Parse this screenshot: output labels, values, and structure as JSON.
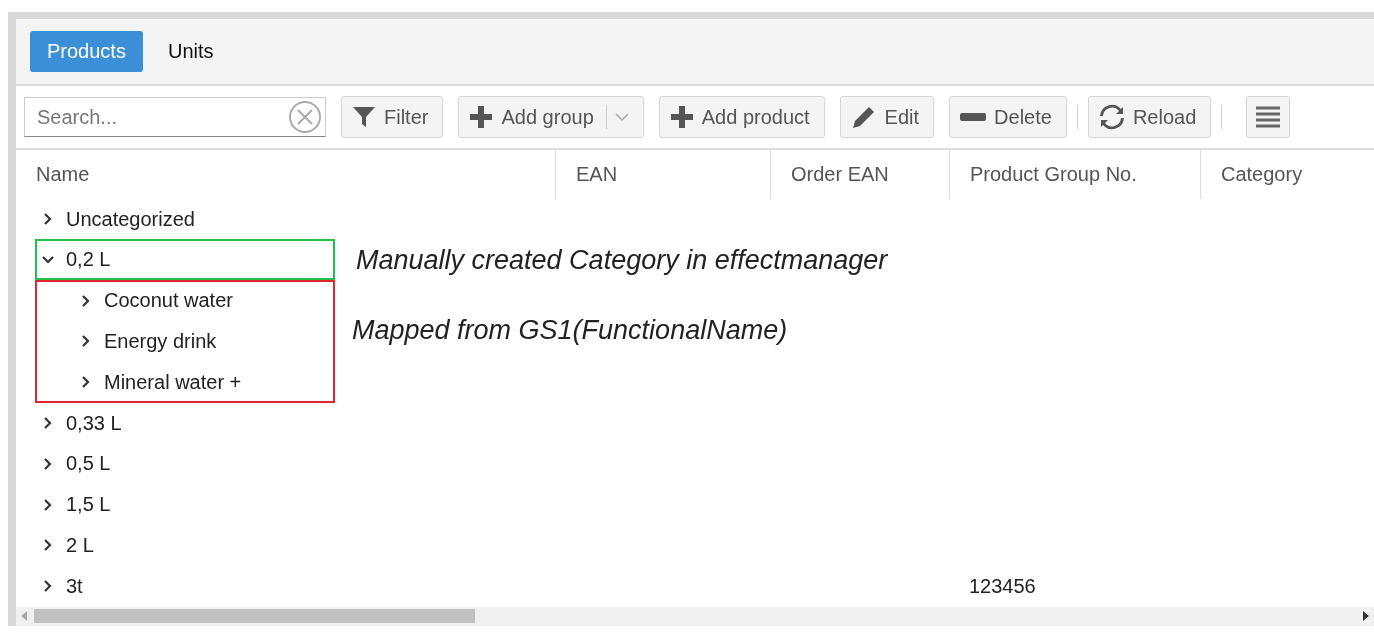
{
  "tabs": [
    {
      "label": "Products",
      "selected": true
    },
    {
      "label": "Units",
      "selected": false
    }
  ],
  "toolbar": {
    "search": {
      "placeholder": "Search..."
    },
    "items": [
      {
        "kind": "button",
        "label": "Filter"
      },
      {
        "kind": "split",
        "label": "Add group"
      },
      {
        "kind": "button",
        "label": "Add product"
      },
      {
        "kind": "button",
        "label": "Edit"
      },
      {
        "kind": "button",
        "label": "Delete"
      },
      {
        "kind": "separator"
      },
      {
        "kind": "button",
        "label": "Reload"
      },
      {
        "kind": "separator"
      },
      {
        "kind": "icon"
      }
    ]
  },
  "table": {
    "columns": [
      "Name",
      "EAN",
      "Order EAN",
      "Product Group No.",
      "Category"
    ],
    "rows": [
      {
        "name": "Uncategorized",
        "expanded": false
      },
      {
        "name": "0,2 L",
        "expanded": true,
        "outline": {
          "color": "#22c24a",
          "note": "Manually created Category in effectmanager"
        },
        "children_outline": {
          "color": "#e0262e",
          "note": "Mapped from GS1(FunctionalName)"
        },
        "children": [
          {
            "name": "Coconut water",
            "expanded": false
          },
          {
            "name": "Energy drink",
            "expanded": false
          },
          {
            "name": "Mineral water +",
            "expanded": false
          }
        ]
      },
      {
        "name": "0,33 L",
        "expanded": false
      },
      {
        "name": "0,5 L",
        "expanded": false
      },
      {
        "name": "1,5 L",
        "expanded": false
      },
      {
        "name": "2 L",
        "expanded": false
      },
      {
        "name": "3t",
        "expanded": false,
        "product_group_no": "123456"
      }
    ]
  }
}
